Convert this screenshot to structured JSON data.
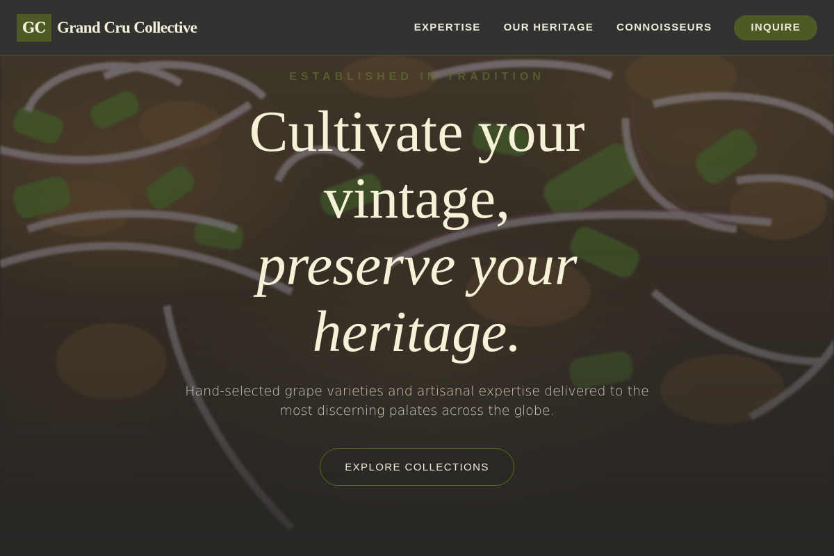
{
  "header": {
    "logo_mark": "GC",
    "brand_name": "Grand Cru Collective",
    "nav": [
      {
        "label": "EXPERTISE"
      },
      {
        "label": "OUR HERITAGE"
      },
      {
        "label": "CONNOISSEURS"
      }
    ],
    "cta_label": "INQUIRE"
  },
  "hero": {
    "eyebrow": "ESTABLISHED IN TRADITION",
    "headline_lines": [
      "Cultivate your",
      "vintage,",
      "preserve your",
      "heritage."
    ],
    "subtext": "Hand-selected grape varieties and artisanal expertise delivered to the most discerning palates across the globe.",
    "button_label": "EXPLORE COLLECTIONS"
  },
  "colors": {
    "header_bg": "#323230",
    "accent_olive": "#4d5a25",
    "headline_cream": "#f5f2d8",
    "overlay_dark": "#2b2a28"
  },
  "icons": {
    "background_image": "food-photo-onion-scallion"
  }
}
